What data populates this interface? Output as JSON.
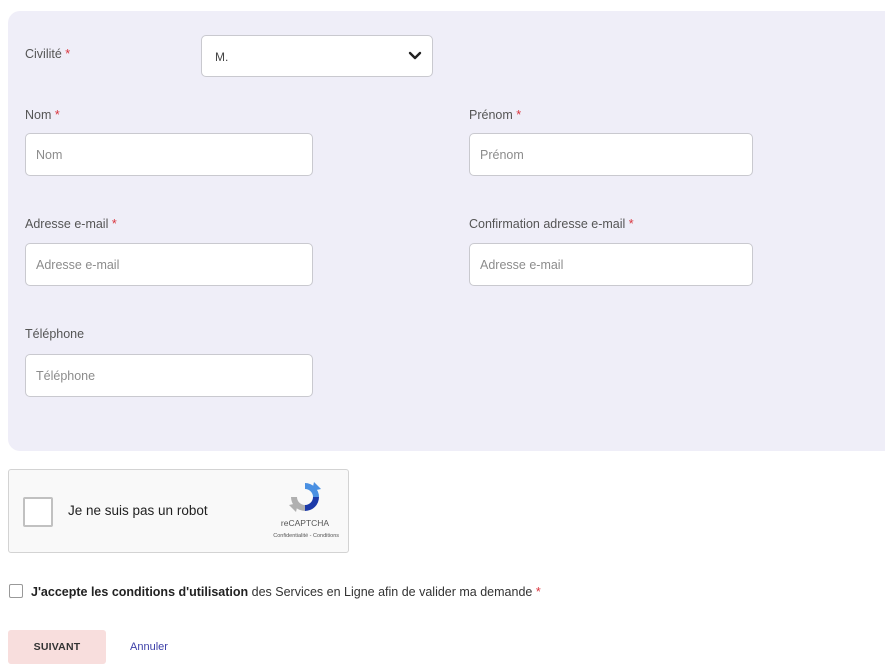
{
  "form": {
    "civilite": {
      "label": "Civilité",
      "required_mark": "*",
      "value": "M."
    },
    "nom": {
      "label": "Nom",
      "required_mark": "*",
      "placeholder": "Nom"
    },
    "prenom": {
      "label": "Prénom",
      "required_mark": "*",
      "placeholder": "Prénom"
    },
    "email": {
      "label": "Adresse e-mail",
      "required_mark": "*",
      "placeholder": "Adresse e-mail"
    },
    "email_confirm": {
      "label": "Confirmation adresse e-mail",
      "required_mark": "*",
      "placeholder": "Adresse e-mail"
    },
    "telephone": {
      "label": "Téléphone",
      "placeholder": "Téléphone"
    }
  },
  "captcha": {
    "label": "Je ne suis pas un robot",
    "brand": "reCAPTCHA",
    "links": "Confidentialité - Conditions"
  },
  "terms": {
    "text_prefix": "J'accepte les",
    "link_text": "conditions d'utilisation",
    "text_suffix": "des Services en Ligne afin de valider ma demande",
    "required_mark": "*"
  },
  "actions": {
    "next_label": "SUIVANT",
    "cancel_label": "Annuler"
  },
  "colors": {
    "panel_bg": "#efeef8",
    "required": "#d9343d",
    "next_button_bg": "#f8dedd",
    "link": "#3c3fa8"
  }
}
